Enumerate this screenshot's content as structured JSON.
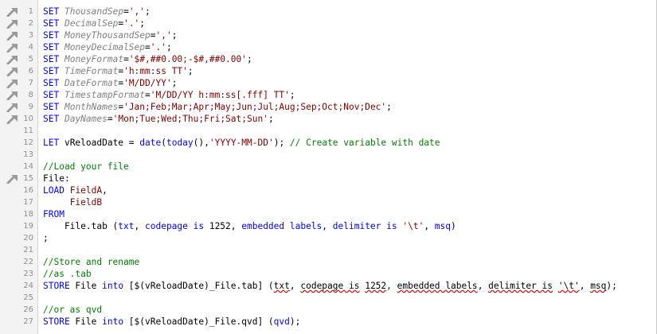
{
  "editor": {
    "lines": [
      {
        "num": "1",
        "marker": true,
        "tokens": [
          {
            "t": "SET",
            "c": "kw"
          },
          {
            "t": " ",
            "c": "txt"
          },
          {
            "t": "ThousandSep",
            "c": "var"
          },
          {
            "t": "=",
            "c": "txt"
          },
          {
            "t": "','",
            "c": "str"
          },
          {
            "t": ";",
            "c": "txt"
          }
        ]
      },
      {
        "num": "2",
        "marker": true,
        "tokens": [
          {
            "t": "SET",
            "c": "kw"
          },
          {
            "t": " ",
            "c": "txt"
          },
          {
            "t": "DecimalSep",
            "c": "var"
          },
          {
            "t": "=",
            "c": "txt"
          },
          {
            "t": "'.'",
            "c": "str"
          },
          {
            "t": ";",
            "c": "txt"
          }
        ]
      },
      {
        "num": "3",
        "marker": true,
        "tokens": [
          {
            "t": "SET",
            "c": "kw"
          },
          {
            "t": " ",
            "c": "txt"
          },
          {
            "t": "MoneyThousandSep",
            "c": "var"
          },
          {
            "t": "=",
            "c": "txt"
          },
          {
            "t": "','",
            "c": "str"
          },
          {
            "t": ";",
            "c": "txt"
          }
        ]
      },
      {
        "num": "4",
        "marker": true,
        "tokens": [
          {
            "t": "SET",
            "c": "kw"
          },
          {
            "t": " ",
            "c": "txt"
          },
          {
            "t": "MoneyDecimalSep",
            "c": "var"
          },
          {
            "t": "=",
            "c": "txt"
          },
          {
            "t": "'.'",
            "c": "str"
          },
          {
            "t": ";",
            "c": "txt"
          }
        ]
      },
      {
        "num": "5",
        "marker": true,
        "tokens": [
          {
            "t": "SET",
            "c": "kw"
          },
          {
            "t": " ",
            "c": "txt"
          },
          {
            "t": "MoneyFormat",
            "c": "var"
          },
          {
            "t": "=",
            "c": "txt"
          },
          {
            "t": "'$#,##0.00;-$#,##0.00'",
            "c": "str"
          },
          {
            "t": ";",
            "c": "txt"
          }
        ]
      },
      {
        "num": "6",
        "marker": true,
        "tokens": [
          {
            "t": "SET",
            "c": "kw"
          },
          {
            "t": " ",
            "c": "txt"
          },
          {
            "t": "TimeFormat",
            "c": "var"
          },
          {
            "t": "=",
            "c": "txt"
          },
          {
            "t": "'h:mm:ss TT'",
            "c": "str"
          },
          {
            "t": ";",
            "c": "txt"
          }
        ]
      },
      {
        "num": "7",
        "marker": true,
        "tokens": [
          {
            "t": "SET",
            "c": "kw"
          },
          {
            "t": " ",
            "c": "txt"
          },
          {
            "t": "DateFormat",
            "c": "var"
          },
          {
            "t": "=",
            "c": "txt"
          },
          {
            "t": "'M/DD/YY'",
            "c": "str"
          },
          {
            "t": ";",
            "c": "txt"
          }
        ]
      },
      {
        "num": "8",
        "marker": true,
        "tokens": [
          {
            "t": "SET",
            "c": "kw"
          },
          {
            "t": " ",
            "c": "txt"
          },
          {
            "t": "TimestampFormat",
            "c": "var"
          },
          {
            "t": "=",
            "c": "txt"
          },
          {
            "t": "'M/DD/YY h:mm:ss[.fff] TT'",
            "c": "str"
          },
          {
            "t": ";",
            "c": "txt"
          }
        ]
      },
      {
        "num": "9",
        "marker": true,
        "tokens": [
          {
            "t": "SET",
            "c": "kw"
          },
          {
            "t": " ",
            "c": "txt"
          },
          {
            "t": "MonthNames",
            "c": "var"
          },
          {
            "t": "=",
            "c": "txt"
          },
          {
            "t": "'Jan;Feb;Mar;Apr;May;Jun;Jul;Aug;Sep;Oct;Nov;Dec'",
            "c": "str"
          },
          {
            "t": ";",
            "c": "txt"
          }
        ]
      },
      {
        "num": "10",
        "marker": true,
        "tokens": [
          {
            "t": "SET",
            "c": "kw"
          },
          {
            "t": " ",
            "c": "txt"
          },
          {
            "t": "DayNames",
            "c": "var"
          },
          {
            "t": "=",
            "c": "txt"
          },
          {
            "t": "'Mon;Tue;Wed;Thu;Fri;Sat;Sun'",
            "c": "str"
          },
          {
            "t": ";",
            "c": "txt"
          }
        ]
      },
      {
        "num": "11",
        "marker": false,
        "tokens": []
      },
      {
        "num": "12",
        "marker": false,
        "tokens": [
          {
            "t": "LET",
            "c": "kw"
          },
          {
            "t": " vReloadDate = ",
            "c": "txt"
          },
          {
            "t": "date",
            "c": "fn"
          },
          {
            "t": "(",
            "c": "txt"
          },
          {
            "t": "today",
            "c": "fn"
          },
          {
            "t": "(),",
            "c": "txt"
          },
          {
            "t": "'YYYY-MM-DD'",
            "c": "str"
          },
          {
            "t": "); ",
            "c": "txt"
          },
          {
            "t": "// Create variable with date",
            "c": "cm"
          }
        ]
      },
      {
        "num": "13",
        "marker": false,
        "tokens": []
      },
      {
        "num": "14",
        "marker": false,
        "tokens": [
          {
            "t": "//Load your file",
            "c": "cm"
          }
        ]
      },
      {
        "num": "15",
        "marker": true,
        "tokens": [
          {
            "t": "File:",
            "c": "id"
          }
        ]
      },
      {
        "num": "16",
        "marker": false,
        "tokens": [
          {
            "t": "LOAD",
            "c": "kw"
          },
          {
            "t": " ",
            "c": "txt"
          },
          {
            "t": "FieldA",
            "c": "field"
          },
          {
            "t": ",",
            "c": "txt"
          }
        ]
      },
      {
        "num": "17",
        "marker": false,
        "tokens": [
          {
            "t": "     ",
            "c": "txt"
          },
          {
            "t": "FieldB",
            "c": "field"
          }
        ]
      },
      {
        "num": "18",
        "marker": false,
        "tokens": [
          {
            "t": "FROM",
            "c": "kw"
          }
        ]
      },
      {
        "num": "19",
        "marker": false,
        "tokens": [
          {
            "t": "    File.tab (",
            "c": "txt"
          },
          {
            "t": "txt",
            "c": "kw"
          },
          {
            "t": ", ",
            "c": "txt"
          },
          {
            "t": "codepage is",
            "c": "kw"
          },
          {
            "t": " 1252, ",
            "c": "txt"
          },
          {
            "t": "embedded labels",
            "c": "kw"
          },
          {
            "t": ", ",
            "c": "txt"
          },
          {
            "t": "delimiter is",
            "c": "kw"
          },
          {
            "t": " ",
            "c": "txt"
          },
          {
            "t": "'\\t'",
            "c": "str"
          },
          {
            "t": ", ",
            "c": "txt"
          },
          {
            "t": "msq",
            "c": "kw"
          },
          {
            "t": ")",
            "c": "txt"
          }
        ]
      },
      {
        "num": "20",
        "marker": false,
        "tokens": [
          {
            "t": ";",
            "c": "txt"
          }
        ]
      },
      {
        "num": "21",
        "marker": false,
        "tokens": []
      },
      {
        "num": "22",
        "marker": false,
        "tokens": [
          {
            "t": "//Store and rename",
            "c": "cm"
          }
        ]
      },
      {
        "num": "23",
        "marker": false,
        "tokens": [
          {
            "t": "//as .tab",
            "c": "cm"
          }
        ]
      },
      {
        "num": "24",
        "marker": false,
        "tokens": [
          {
            "t": "STORE",
            "c": "kw"
          },
          {
            "t": " File ",
            "c": "txt"
          },
          {
            "t": "into",
            "c": "kw"
          },
          {
            "t": " [$(vReloadDate)_File.tab] (",
            "c": "txt"
          },
          {
            "t": "txt",
            "c": "txt",
            "sq": true
          },
          {
            "t": ", ",
            "c": "txt"
          },
          {
            "t": "codepage is",
            "c": "txt",
            "sq": true
          },
          {
            "t": " ",
            "c": "txt"
          },
          {
            "t": "1252",
            "c": "txt",
            "sq": true
          },
          {
            "t": ", ",
            "c": "txt"
          },
          {
            "t": "embedded labels",
            "c": "txt",
            "sq": true
          },
          {
            "t": ", ",
            "c": "txt"
          },
          {
            "t": "delimiter is",
            "c": "txt",
            "sq": true
          },
          {
            "t": " ",
            "c": "txt"
          },
          {
            "t": "'\\t'",
            "c": "txt",
            "sq": true
          },
          {
            "t": ", ",
            "c": "txt"
          },
          {
            "t": "msq",
            "c": "txt",
            "sq": true
          },
          {
            "t": ");",
            "c": "txt"
          }
        ]
      },
      {
        "num": "25",
        "marker": false,
        "tokens": []
      },
      {
        "num": "26",
        "marker": false,
        "tokens": [
          {
            "t": "//or as qvd",
            "c": "cm"
          }
        ]
      },
      {
        "num": "27",
        "marker": false,
        "tokens": [
          {
            "t": "STORE",
            "c": "kw"
          },
          {
            "t": " File ",
            "c": "txt"
          },
          {
            "t": "into",
            "c": "kw"
          },
          {
            "t": " [$(vReloadDate)_File.qvd] (",
            "c": "txt"
          },
          {
            "t": "qvd",
            "c": "kw"
          },
          {
            "t": ");",
            "c": "txt"
          }
        ]
      }
    ]
  },
  "colors": {
    "keyword": "#0000ff",
    "variable": "#808080",
    "string": "#800000",
    "comment": "#008000",
    "gutter_bg": "#f3f3f3",
    "line_number": "#8e8e8e",
    "squiggle": "#d40000"
  },
  "icons": {
    "line_marker": "pin-arrow-icon"
  }
}
